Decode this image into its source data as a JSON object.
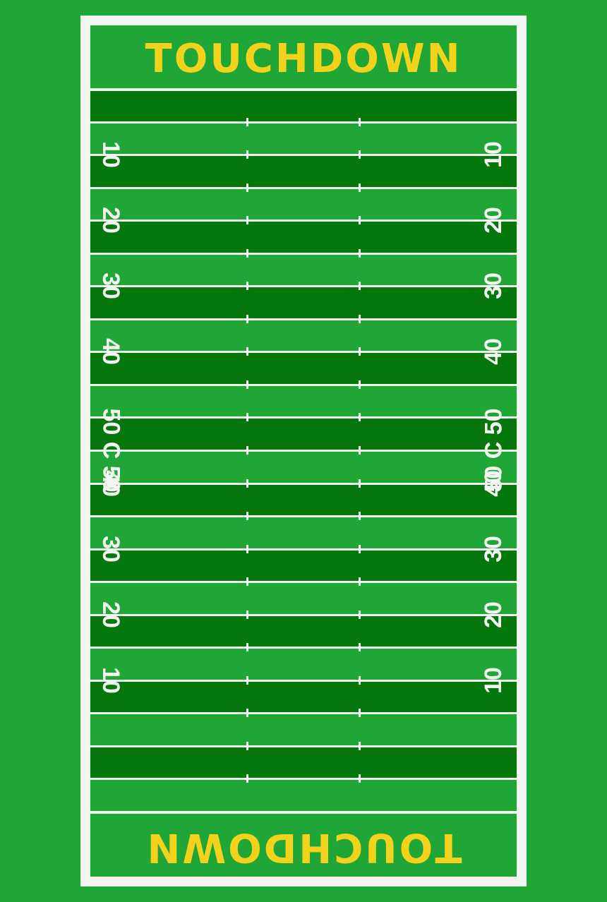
{
  "endzones": {
    "top_label": "TOUCHDOWN",
    "bottom_label": "TOUCHDOWN"
  },
  "yard_markers": [
    "10",
    "20",
    "30",
    "40",
    "50 C 50",
    "40",
    "30",
    "20",
    "10"
  ],
  "colors": {
    "background": "#20a637",
    "field_light": "#20a637",
    "field_dark": "#06770d",
    "lines": "#f2f5ef",
    "endzone_text": "#f2d21b",
    "numbers": "#f2f5ef"
  }
}
